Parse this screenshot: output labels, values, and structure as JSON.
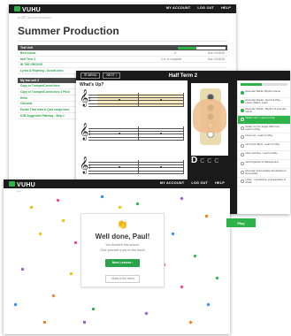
{
  "brand": {
    "logo_text": "VUHU",
    "logo_sub": "music"
  },
  "nav": [
    "MY ACCOUNT",
    "LOG OUT",
    "HELP"
  ],
  "course": {
    "breadcrumb": "Home > Summer Production",
    "title": "Summer Production",
    "units": [
      {
        "heading": "Test Unit",
        "progress": 0.38,
        "rows": [
          {
            "label": "Best sound",
            "done": true,
            "meta": "",
            "due": "Due 01/06/18"
          },
          {
            "label": "Half Term 2",
            "done": false,
            "meta": "3 of 11 complete",
            "due": "Due 21/06/18"
          },
          {
            "label": "IN THE GROOVE",
            "done": false,
            "meta": "",
            "due": ""
          },
          {
            "label": "Lyrics & Rhyming - Scrolls Intro",
            "done": false,
            "meta": "",
            "due": ""
          }
        ]
      },
      {
        "heading": "My test unit 2",
        "progress": 0.0,
        "rows": [
          {
            "label": "Copy or Trumpet/Cornet Intro",
            "done": false,
            "meta": "",
            "due": ""
          },
          {
            "label": "Copy or Trumpet/Cornet Intro 2 Pitch",
            "done": false,
            "meta": "",
            "due": ""
          },
          {
            "label": "Hello",
            "done": false,
            "meta": "",
            "due": ""
          },
          {
            "label": "Calculus",
            "done": false,
            "meta": "",
            "due": ""
          },
          {
            "label": "Puzzle Time Intro & Quiz songs intro",
            "done": false,
            "meta": "",
            "due": ""
          },
          {
            "label": "DJB Suggested Pathway - Step 1",
            "done": false,
            "meta": "",
            "due": ""
          }
        ]
      }
    ]
  },
  "lesson": {
    "menu_label": "MENU",
    "next_label": "NEXT",
    "title": "Half Term 2",
    "question": "What's Up?",
    "timesig": "4 4",
    "big_note": "D",
    "small_notes": [
      "C",
      "C",
      "C"
    ],
    "progress": 0.45,
    "steps": [
      {
        "text": "Recorder Starter Rhythm Game",
        "done": true,
        "active": false
      },
      {
        "text": "Recorder Starter: Sound & Play - Listen, Watch, Learn",
        "done": true,
        "active": false
      },
      {
        "text": "Recorder Starter: Rhythm & Intervals Game",
        "done": true,
        "active": false
      },
      {
        "text": "What's Up? - Learn to Play",
        "done": false,
        "active": true
      },
      {
        "text": "Ready for the Jungle Warm-Up - Learn to Play",
        "done": false,
        "active": false
      },
      {
        "text": "Down Go - Learn to Play",
        "done": false,
        "active": false
      },
      {
        "text": "Hot Cross Buns - Learn to Play",
        "done": false,
        "active": false
      },
      {
        "text": "Hear and See - Learn to Play",
        "done": false,
        "active": false
      },
      {
        "text": "Hold Together for Background",
        "done": false,
        "active": false
      },
      {
        "text": "Recorder Intermediate Introduction to Ensembles",
        "done": false,
        "active": false
      },
      {
        "text": "Listen - Introduction to Ensembles of Music",
        "done": false,
        "active": false
      }
    ]
  },
  "completion": {
    "icon": "clapping-hands-icon",
    "heading": "Well done, Paul!",
    "line1": "You finished this lesson.",
    "line2": "Give yourself a pat on the back!",
    "next_label": "Next Lesson",
    "back_label": "Back to the menu",
    "peek_label": "Play"
  },
  "colors": {
    "brand_green": "#2db34a",
    "topbar": "#1c1c1c",
    "lesson_bg": "#1b1b1b",
    "highlight": "#f5e6b0"
  }
}
